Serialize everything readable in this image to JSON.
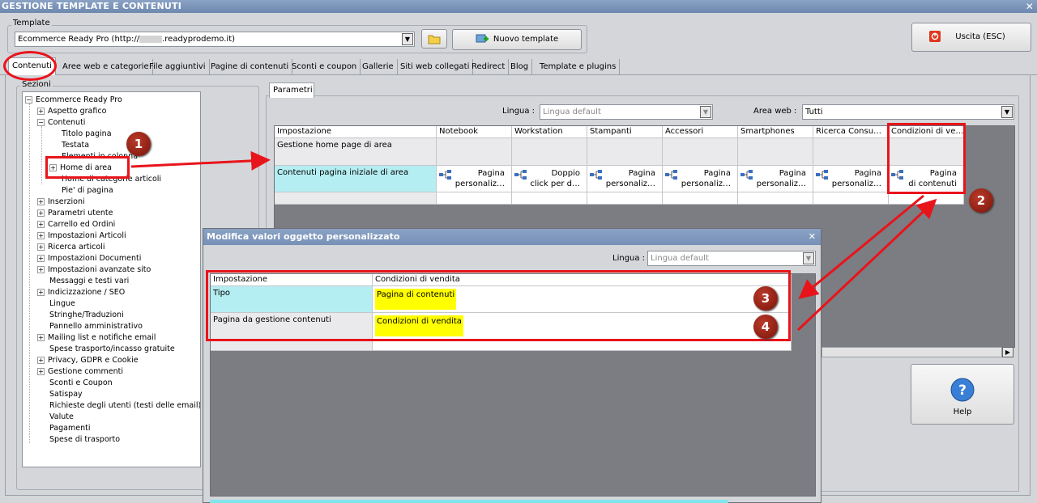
{
  "window": {
    "title": "GESTIONE TEMPLATE E CONTENUTI"
  },
  "template": {
    "group_label": "Template",
    "selected": "Ecommerce Ready Pro (http://",
    "selected_suffix": ".readyprodemo.it)",
    "new_button": "Nuovo template",
    "exit_button": "Uscita (ESC)"
  },
  "tabs": [
    "Contenuti",
    "Aree web e categorie",
    "File aggiuntivi",
    "Pagine di contenuti",
    "Sconti e coupon",
    "Gallerie",
    "Siti web collegati",
    "Redirect",
    "Blog",
    "Template e plugins"
  ],
  "sections": {
    "label": "Sezioni",
    "root": "Ecommerce Ready Pro",
    "items": [
      {
        "label": "Aspetto grafico",
        "expander": "+"
      },
      {
        "label": "Contenuti",
        "expander": "−"
      },
      {
        "label": "Titolo pagina",
        "expander": ""
      },
      {
        "label": "Testata",
        "expander": ""
      },
      {
        "label": "Elementi in colonna",
        "expander": ""
      },
      {
        "label": "Home di area",
        "expander": "+"
      },
      {
        "label": "Home di categorie articoli",
        "expander": ""
      },
      {
        "label": "Pie' di pagina",
        "expander": ""
      },
      {
        "label": "Inserzioni",
        "expander": "+"
      },
      {
        "label": "Parametri utente",
        "expander": "+"
      },
      {
        "label": "Carrello ed Ordini",
        "expander": "+"
      },
      {
        "label": "Impostazioni Articoli",
        "expander": "+"
      },
      {
        "label": "Ricerca articoli",
        "expander": "+"
      },
      {
        "label": "Impostazioni Documenti",
        "expander": "+"
      },
      {
        "label": "Impostazioni avanzate sito",
        "expander": "+"
      },
      {
        "label": "Messaggi e testi vari",
        "expander": ""
      },
      {
        "label": "Indicizzazione / SEO",
        "expander": "+"
      },
      {
        "label": "Lingue",
        "expander": ""
      },
      {
        "label": "Stringhe/Traduzioni",
        "expander": ""
      },
      {
        "label": "Pannello amministrativo",
        "expander": ""
      },
      {
        "label": "Mailing list e notifiche email",
        "expander": "+"
      },
      {
        "label": "Spese trasporto/incasso gratuite",
        "expander": ""
      },
      {
        "label": "Privacy, GDPR e Cookie",
        "expander": "+"
      },
      {
        "label": "Gestione commenti",
        "expander": "+"
      },
      {
        "label": "Sconti e Coupon",
        "expander": ""
      },
      {
        "label": "Satispay",
        "expander": ""
      },
      {
        "label": "Richieste degli utenti (testi delle email)",
        "expander": ""
      },
      {
        "label": "Valute",
        "expander": ""
      },
      {
        "label": "Pagamenti",
        "expander": ""
      },
      {
        "label": "Spese di trasporto",
        "expander": ""
      }
    ]
  },
  "params": {
    "tab": "Parametri",
    "lingua_label": "Lingua :",
    "lingua_value": "Lingua default",
    "area_label": "Area web :",
    "area_value": "Tutti",
    "columns": [
      "Impostazione",
      "Notebook",
      "Workstation",
      "Stampanti",
      "Accessori",
      "Smartphones",
      "Ricerca Consu…",
      "Condizioni di ve…"
    ],
    "row1": "Gestione home page di area",
    "row2": "Contenuti pagina iniziale di area",
    "row2_values": [
      [
        "Pagina",
        "personaliz…"
      ],
      [
        "Doppio",
        "click per d…"
      ],
      [
        "Pagina",
        "personaliz…"
      ],
      [
        "Pagina",
        "personaliz…"
      ],
      [
        "Pagina",
        "personaliz…"
      ],
      [
        "Pagina",
        "personaliz…"
      ],
      [
        "Pagina",
        "di contenuti"
      ]
    ]
  },
  "help_button": "Help",
  "dialog": {
    "title": "Modifica valori oggetto personalizzato",
    "lingua_label": "Lingua :",
    "lingua_value": "Lingua default",
    "col1": "Impostazione",
    "col2": "Condizioni di vendita",
    "row1_label": "Tipo",
    "row1_value": "Pagina di contenuti",
    "row2_label": "Pagina da gestione contenuti",
    "row2_value": "Condizioni di vendita"
  },
  "badges": [
    "1",
    "2",
    "3",
    "4"
  ],
  "colors": {
    "annotation": "#e8141b",
    "highlight": "#ffff00",
    "cyan": "#b5eef2",
    "titlebar": "#7790b7"
  }
}
